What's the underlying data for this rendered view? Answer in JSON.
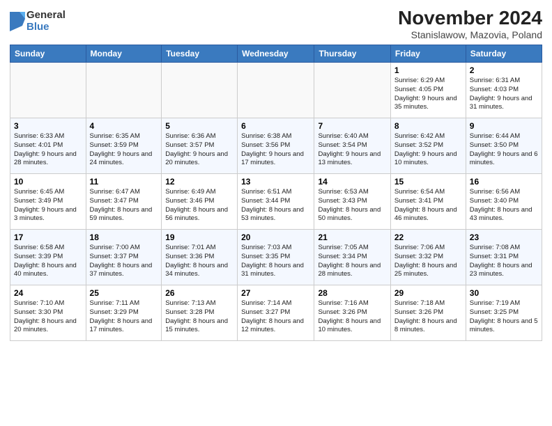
{
  "header": {
    "logo": {
      "general": "General",
      "blue": "Blue"
    },
    "title": "November 2024",
    "subtitle": "Stanislawow, Mazovia, Poland"
  },
  "weekdays": [
    "Sunday",
    "Monday",
    "Tuesday",
    "Wednesday",
    "Thursday",
    "Friday",
    "Saturday"
  ],
  "weeks": [
    [
      {
        "day": "",
        "info": ""
      },
      {
        "day": "",
        "info": ""
      },
      {
        "day": "",
        "info": ""
      },
      {
        "day": "",
        "info": ""
      },
      {
        "day": "",
        "info": ""
      },
      {
        "day": "1",
        "info": "Sunrise: 6:29 AM\nSunset: 4:05 PM\nDaylight: 9 hours and 35 minutes."
      },
      {
        "day": "2",
        "info": "Sunrise: 6:31 AM\nSunset: 4:03 PM\nDaylight: 9 hours and 31 minutes."
      }
    ],
    [
      {
        "day": "3",
        "info": "Sunrise: 6:33 AM\nSunset: 4:01 PM\nDaylight: 9 hours and 28 minutes."
      },
      {
        "day": "4",
        "info": "Sunrise: 6:35 AM\nSunset: 3:59 PM\nDaylight: 9 hours and 24 minutes."
      },
      {
        "day": "5",
        "info": "Sunrise: 6:36 AM\nSunset: 3:57 PM\nDaylight: 9 hours and 20 minutes."
      },
      {
        "day": "6",
        "info": "Sunrise: 6:38 AM\nSunset: 3:56 PM\nDaylight: 9 hours and 17 minutes."
      },
      {
        "day": "7",
        "info": "Sunrise: 6:40 AM\nSunset: 3:54 PM\nDaylight: 9 hours and 13 minutes."
      },
      {
        "day": "8",
        "info": "Sunrise: 6:42 AM\nSunset: 3:52 PM\nDaylight: 9 hours and 10 minutes."
      },
      {
        "day": "9",
        "info": "Sunrise: 6:44 AM\nSunset: 3:50 PM\nDaylight: 9 hours and 6 minutes."
      }
    ],
    [
      {
        "day": "10",
        "info": "Sunrise: 6:45 AM\nSunset: 3:49 PM\nDaylight: 9 hours and 3 minutes."
      },
      {
        "day": "11",
        "info": "Sunrise: 6:47 AM\nSunset: 3:47 PM\nDaylight: 8 hours and 59 minutes."
      },
      {
        "day": "12",
        "info": "Sunrise: 6:49 AM\nSunset: 3:46 PM\nDaylight: 8 hours and 56 minutes."
      },
      {
        "day": "13",
        "info": "Sunrise: 6:51 AM\nSunset: 3:44 PM\nDaylight: 8 hours and 53 minutes."
      },
      {
        "day": "14",
        "info": "Sunrise: 6:53 AM\nSunset: 3:43 PM\nDaylight: 8 hours and 50 minutes."
      },
      {
        "day": "15",
        "info": "Sunrise: 6:54 AM\nSunset: 3:41 PM\nDaylight: 8 hours and 46 minutes."
      },
      {
        "day": "16",
        "info": "Sunrise: 6:56 AM\nSunset: 3:40 PM\nDaylight: 8 hours and 43 minutes."
      }
    ],
    [
      {
        "day": "17",
        "info": "Sunrise: 6:58 AM\nSunset: 3:39 PM\nDaylight: 8 hours and 40 minutes."
      },
      {
        "day": "18",
        "info": "Sunrise: 7:00 AM\nSunset: 3:37 PM\nDaylight: 8 hours and 37 minutes."
      },
      {
        "day": "19",
        "info": "Sunrise: 7:01 AM\nSunset: 3:36 PM\nDaylight: 8 hours and 34 minutes."
      },
      {
        "day": "20",
        "info": "Sunrise: 7:03 AM\nSunset: 3:35 PM\nDaylight: 8 hours and 31 minutes."
      },
      {
        "day": "21",
        "info": "Sunrise: 7:05 AM\nSunset: 3:34 PM\nDaylight: 8 hours and 28 minutes."
      },
      {
        "day": "22",
        "info": "Sunrise: 7:06 AM\nSunset: 3:32 PM\nDaylight: 8 hours and 25 minutes."
      },
      {
        "day": "23",
        "info": "Sunrise: 7:08 AM\nSunset: 3:31 PM\nDaylight: 8 hours and 23 minutes."
      }
    ],
    [
      {
        "day": "24",
        "info": "Sunrise: 7:10 AM\nSunset: 3:30 PM\nDaylight: 8 hours and 20 minutes."
      },
      {
        "day": "25",
        "info": "Sunrise: 7:11 AM\nSunset: 3:29 PM\nDaylight: 8 hours and 17 minutes."
      },
      {
        "day": "26",
        "info": "Sunrise: 7:13 AM\nSunset: 3:28 PM\nDaylight: 8 hours and 15 minutes."
      },
      {
        "day": "27",
        "info": "Sunrise: 7:14 AM\nSunset: 3:27 PM\nDaylight: 8 hours and 12 minutes."
      },
      {
        "day": "28",
        "info": "Sunrise: 7:16 AM\nSunset: 3:26 PM\nDaylight: 8 hours and 10 minutes."
      },
      {
        "day": "29",
        "info": "Sunrise: 7:18 AM\nSunset: 3:26 PM\nDaylight: 8 hours and 8 minutes."
      },
      {
        "day": "30",
        "info": "Sunrise: 7:19 AM\nSunset: 3:25 PM\nDaylight: 8 hours and 5 minutes."
      }
    ]
  ]
}
